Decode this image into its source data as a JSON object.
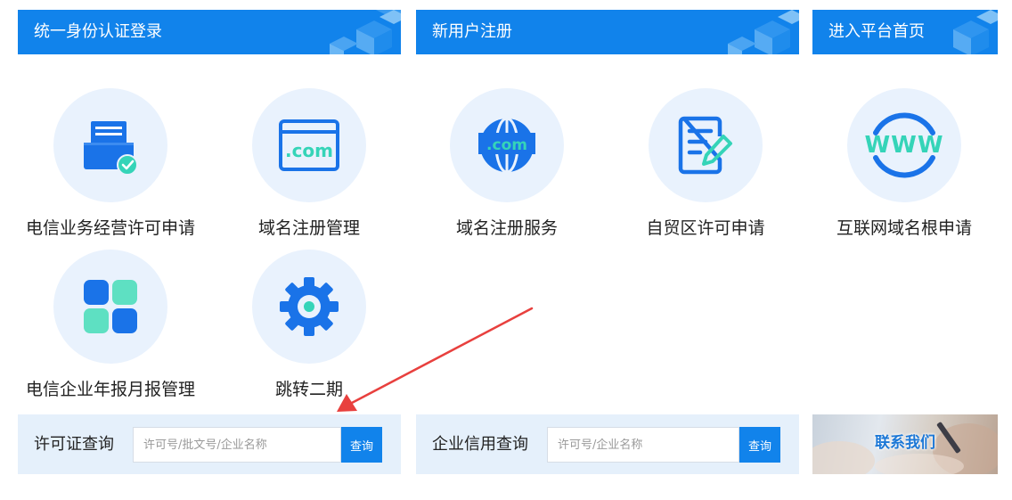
{
  "banners": {
    "login": "统一身份认证登录",
    "register": "新用户注册",
    "home": "进入平台首页"
  },
  "tiles": [
    {
      "label": "电信业务经营许可申请",
      "icon": "license-form-icon"
    },
    {
      "label": "域名注册管理",
      "icon": "dotcom-window-icon"
    },
    {
      "label": "域名注册服务",
      "icon": "dotcom-globe-icon"
    },
    {
      "label": "自贸区许可申请",
      "icon": "document-edit-icon"
    },
    {
      "label": "互联网域名根申请",
      "icon": "www-icon"
    },
    {
      "label": "电信企业年报月报管理",
      "icon": "grid-tiles-icon"
    },
    {
      "label": "跳转二期",
      "icon": "gear-icon"
    }
  ],
  "license_query": {
    "title": "许可证查询",
    "placeholder": "许可号/批文号/企业名称",
    "button": "查询"
  },
  "credit_query": {
    "title": "企业信用查询",
    "placeholder": "许可号/企业名称",
    "button": "查询"
  },
  "contact": {
    "label": "联系我们"
  },
  "colors": {
    "primary": "#1183eb",
    "icon_blue": "#1a73e8",
    "icon_teal": "#35d4b8",
    "circle_bg": "#e9f2fd",
    "query_bg": "#e5f0fb",
    "annotation_arrow": "#e8403e"
  }
}
